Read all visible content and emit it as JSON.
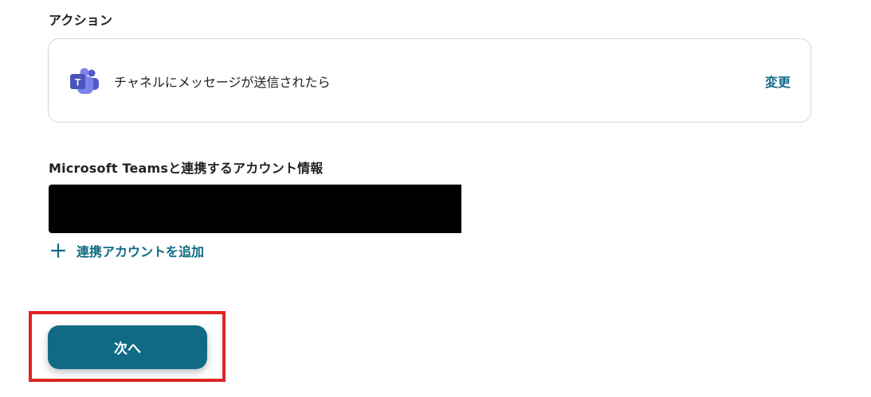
{
  "action_section": {
    "label": "アクション",
    "trigger_text": "チャネルにメッセージが送信されたら",
    "change_label": "変更",
    "app_icon": "microsoft-teams-icon"
  },
  "account_section": {
    "label": "Microsoft Teamsと連携するアカウント情報",
    "add_account_label": "連携アカウントを追加",
    "add_icon": "plus-icon"
  },
  "footer": {
    "next_label": "次へ"
  },
  "colors": {
    "accent": "#0f6b84",
    "highlight": "#e02424",
    "teams_purple": "#5059c9"
  }
}
